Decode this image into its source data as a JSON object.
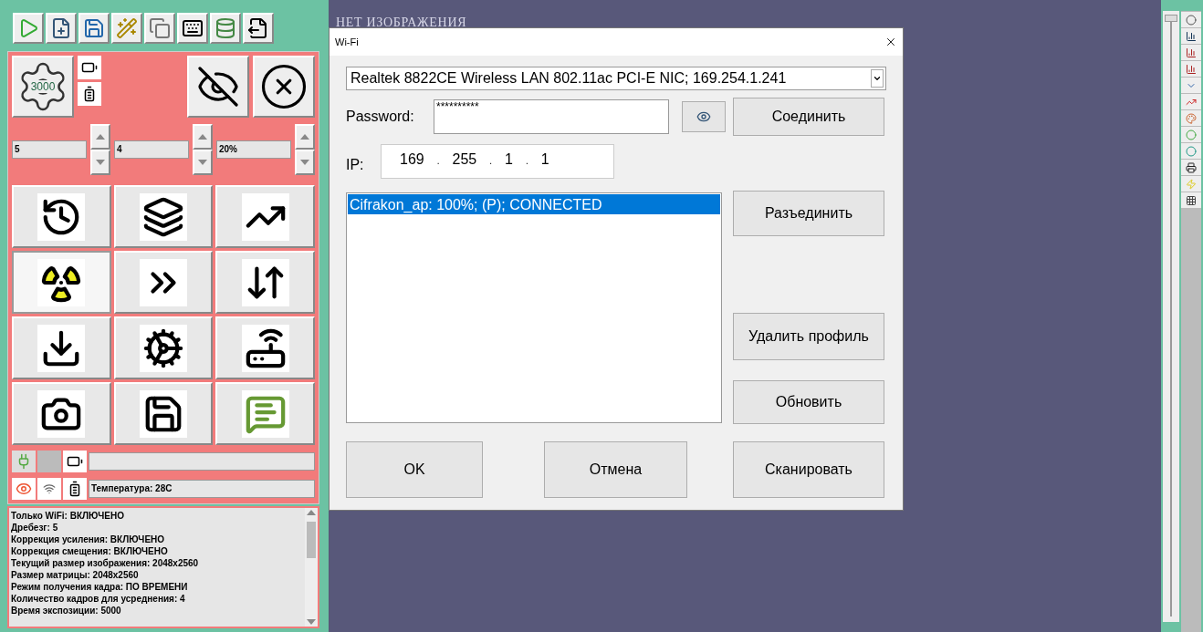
{
  "left_panel": {
    "gear_value": "3000",
    "spinners": [
      {
        "value": "5"
      },
      {
        "value": "4"
      },
      {
        "value": "20%"
      }
    ],
    "tools": [
      {
        "selected": false
      },
      {
        "selected": false
      },
      {
        "selected": false
      },
      {
        "selected": true
      },
      {
        "selected": false
      },
      {
        "selected": false
      },
      {
        "selected": false
      },
      {
        "selected": false
      },
      {
        "selected": false
      },
      {
        "selected": false
      },
      {
        "selected": false
      },
      {
        "selected": false
      }
    ],
    "temperature": "Температура: 28C",
    "log": [
      "Только WiFi: ВКЛЮЧЕНО",
      "Дребезг: 5",
      "Коррекция усиления: ВКЛЮЧЕНО",
      "Коррекция смещения: ВКЛЮЧЕНО",
      "Текущий размер изображения: 2048x2560",
      "Размер матрицы: 2048x2560",
      "Режим получения кадра: ПО ВРЕМЕНИ",
      "Количество кадров для усреднения: 4",
      "Время экспозиции: 5000"
    ]
  },
  "viewer": {
    "caption": "НЕТ ИЗОБРАЖЕНИЯ"
  },
  "side_slider": {
    "level": 1
  },
  "dialog": {
    "title": "Wi-Fi",
    "adapter": "Realtek 8822CE Wireless LAN 802.11ac PCI-E NIC; 169.254.1.241",
    "password_label": "Password:",
    "password": "**********",
    "connect": "Соединить",
    "ip_label": "IP:",
    "ip": [
      "169",
      "255",
      "1",
      "1"
    ],
    "ip_separators": [
      ".",
      ".",
      "."
    ],
    "networks": [
      {
        "text": "Cifrakon_ap: 100%; (P); CONNECTED",
        "selected": true
      }
    ],
    "disconnect": "Разъединить",
    "delete_profile": "Удалить профиль",
    "refresh": "Обновить",
    "ok": "OK",
    "cancel": "Отмена",
    "scan": "Сканировать"
  }
}
